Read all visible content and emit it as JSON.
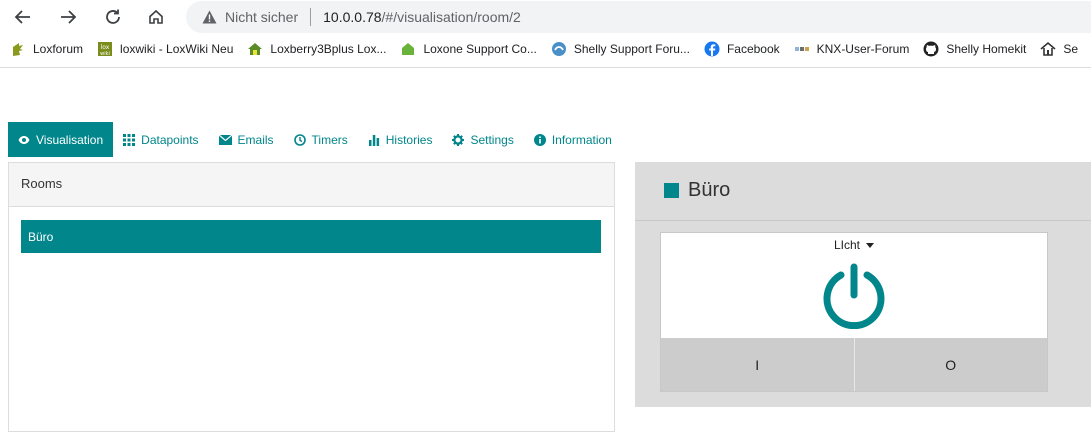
{
  "browser": {
    "security_text": "Nicht sicher",
    "url_host": "10.0.0.78",
    "url_path": "/#/visualisation/room/2"
  },
  "bookmarks": [
    {
      "label": "Loxforum",
      "icon": "loxforum-icon"
    },
    {
      "label": "loxwiki - LoxWiki Neu",
      "icon": "loxwiki-icon"
    },
    {
      "label": "Loxberry3Bplus Lox...",
      "icon": "house-icon"
    },
    {
      "label": "Loxone Support Co...",
      "icon": "loxone-icon"
    },
    {
      "label": "Shelly Support Foru...",
      "icon": "shelly-icon"
    },
    {
      "label": "Facebook",
      "icon": "facebook-icon"
    },
    {
      "label": "KNX-User-Forum",
      "icon": "knx-icon"
    },
    {
      "label": "Shelly Homekit",
      "icon": "github-icon"
    },
    {
      "label": "Se",
      "icon": "home-icon"
    }
  ],
  "tabs": [
    {
      "label": "Visualisation",
      "icon": "eye-icon",
      "active": true
    },
    {
      "label": "Datapoints",
      "icon": "grid-icon"
    },
    {
      "label": "Emails",
      "icon": "envelope-icon"
    },
    {
      "label": "Timers",
      "icon": "clock-icon"
    },
    {
      "label": "Histories",
      "icon": "bar-chart-icon"
    },
    {
      "label": "Settings",
      "icon": "gear-icon"
    },
    {
      "label": "Information",
      "icon": "info-icon"
    }
  ],
  "rooms": {
    "heading": "Rooms",
    "items": [
      {
        "label": "Büro",
        "selected": true
      }
    ]
  },
  "room_view": {
    "title": "Büro",
    "widget": {
      "label": "LIcht",
      "icon": "power-icon",
      "on_label": "I",
      "off_label": "O"
    }
  },
  "colors": {
    "accent": "#00868b",
    "panel_bg": "#dcdcdc",
    "button_bg": "#cccccc"
  }
}
